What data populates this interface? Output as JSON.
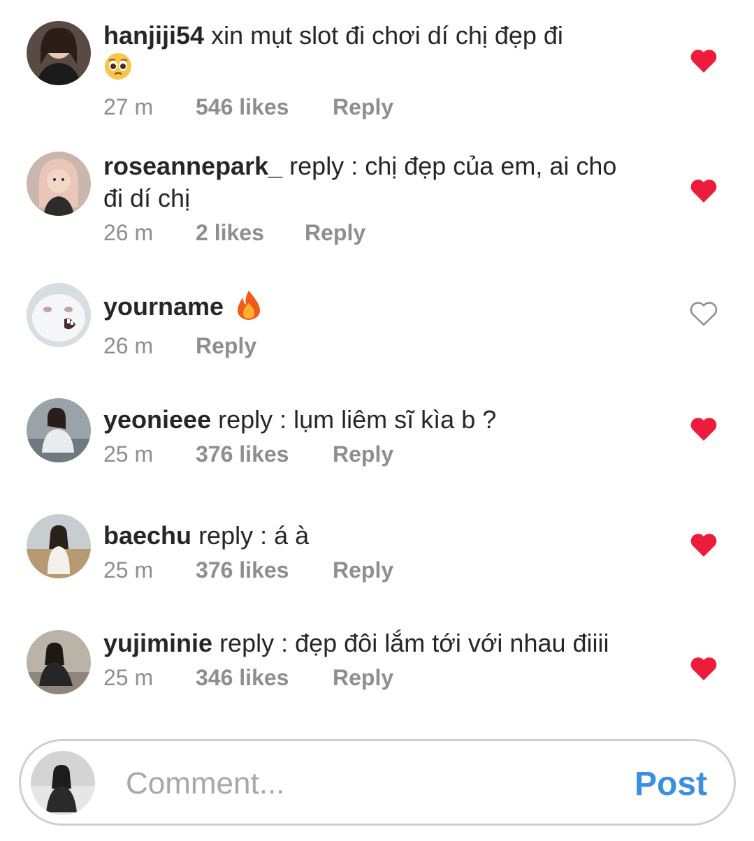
{
  "comments": [
    {
      "username": "hanjiji54",
      "text": "xin mụt slot đi chơi dí chị đẹp đi",
      "emoji": "pleading-face",
      "time": "27 m",
      "likes": "546 likes",
      "reply": "Reply",
      "liked": true
    },
    {
      "username": "roseannepark_",
      "text": "reply : chị đẹp của em, ai cho đi dí chị",
      "time": "26 m",
      "likes": "2 likes",
      "reply": "Reply",
      "liked": true
    },
    {
      "username": "yourname",
      "text": "",
      "emoji": "fire",
      "time": "26 m",
      "likes": "",
      "reply": "Reply",
      "liked": false
    },
    {
      "username": "yeonieee",
      "text": "reply : lụm liêm sĩ kìa b ?",
      "time": "25 m",
      "likes": "376 likes",
      "reply": "Reply",
      "liked": true
    },
    {
      "username": "baechu",
      "text": "reply : á à",
      "time": "25 m",
      "likes": "376 likes",
      "reply": "Reply",
      "liked": true
    },
    {
      "username": "yujiminie",
      "text": "reply : đẹp đôi lắm tới với nhau điiii",
      "time": "25 m",
      "likes": "346 likes",
      "reply": "Reply",
      "liked": true
    }
  ],
  "composer": {
    "placeholder": "Comment...",
    "post_label": "Post"
  },
  "colors": {
    "heart_red": "#ed1c3a",
    "post_blue": "#3b8fe0",
    "meta_gray": "#8e8e8e"
  }
}
